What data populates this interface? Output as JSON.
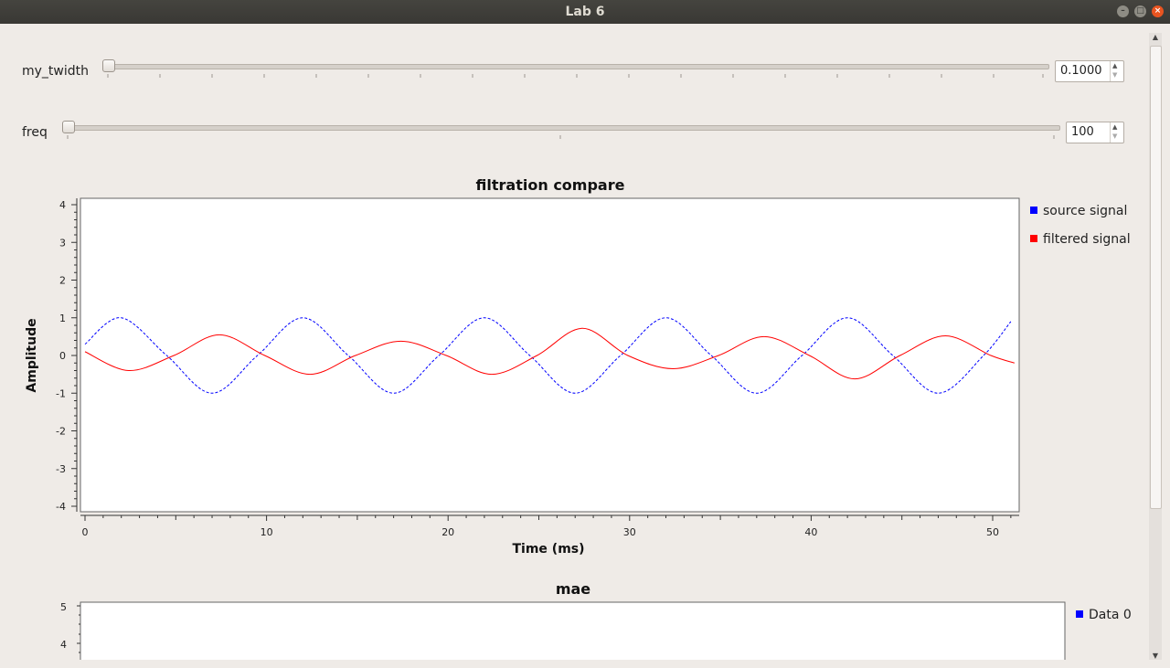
{
  "window": {
    "title": "Lab 6"
  },
  "controls": {
    "twidth": {
      "label": "my_twidth",
      "value": "0.1000",
      "level": 0.0
    },
    "freq": {
      "label": "freq",
      "value": "100",
      "level": 0.0
    }
  },
  "plot1": {
    "chart_data": {
      "type": "line",
      "title": "filtration compare",
      "xlabel": "Time (ms)",
      "ylabel": "Amplitude",
      "xlim": [
        0,
        51.2
      ],
      "ylim": [
        -4,
        4
      ],
      "x_ticks": [
        "0",
        "10",
        "20",
        "30",
        "40",
        "50"
      ],
      "y_ticks": [
        "4",
        "3",
        "2",
        "1",
        "0",
        "-1",
        "-2",
        "-3",
        "-4"
      ],
      "legend_position": "right",
      "series": [
        {
          "name": "source signal",
          "color": "#0000ff",
          "style": "dashed",
          "x": [
            0,
            2,
            4.5,
            7,
            9.5,
            12,
            14.5,
            17,
            19.5,
            22,
            24.5,
            27,
            29.5,
            32,
            34.5,
            37,
            39.5,
            42,
            44.5,
            47,
            49.5,
            51
          ],
          "y": [
            0.3,
            1,
            0,
            -1,
            0,
            1,
            0,
            -1,
            0,
            1,
            0,
            -1,
            0,
            1,
            0,
            -1,
            0,
            1,
            0,
            -1,
            0,
            0.9
          ]
        },
        {
          "name": "filtered signal",
          "color": "#ff0000",
          "style": "solid",
          "x": [
            0,
            2.4,
            4.9,
            7.4,
            9.9,
            12.4,
            14.9,
            17.4,
            19.9,
            22.4,
            24.9,
            27.4,
            29.9,
            32.4,
            34.9,
            37.4,
            39.9,
            42.4,
            44.9,
            47.4,
            49.9,
            51.2
          ],
          "y": [
            0.1,
            -0.4,
            0,
            0.55,
            0,
            -0.5,
            0,
            0.38,
            0,
            -0.5,
            0,
            0.72,
            0,
            -0.35,
            0,
            0.5,
            0,
            -0.62,
            0,
            0.52,
            0,
            -0.2
          ]
        }
      ]
    }
  },
  "plot2": {
    "chart_data": {
      "type": "line",
      "title": "mae",
      "y_ticks": [
        "5",
        "4"
      ],
      "series": [
        {
          "name": "Data 0",
          "color": "#0000ff"
        }
      ]
    }
  }
}
